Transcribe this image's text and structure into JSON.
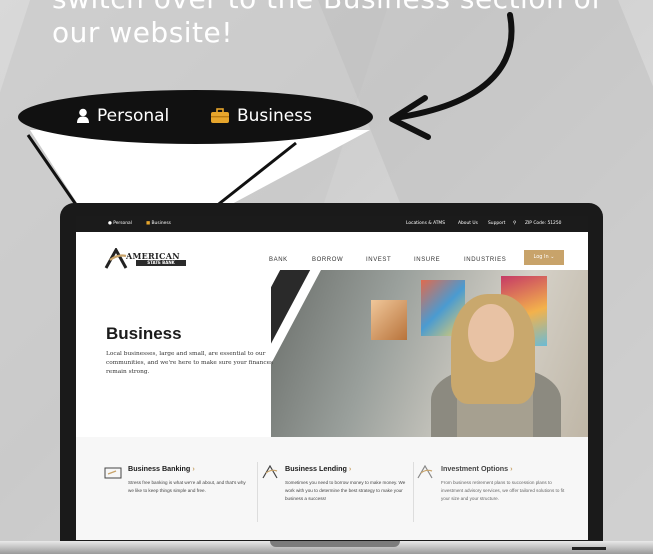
{
  "headline": {
    "line1": "switch over to the Business section of",
    "line2": "our website!"
  },
  "pill": {
    "personal_label": "Personal",
    "business_label": "Business"
  },
  "topbar": {
    "personal": "Personal",
    "business": "Business",
    "locations": "Locations & ATMS",
    "about": "About Us",
    "support": "Support",
    "zip": "ZIP Code: 51250"
  },
  "logo": {
    "name": "AMERICAN",
    "sub": "STATE BANK"
  },
  "nav": {
    "bank": "BANK",
    "borrow": "BORROW",
    "invest": "INVEST",
    "insure": "INSURE",
    "industries": "INDUSTRIES",
    "login": "Log In"
  },
  "hero": {
    "title": "Business",
    "description": "Local businesses, large and small, are essential to our communities, and we're here to make sure your finances remain strong."
  },
  "cards": [
    {
      "title": "Business Banking",
      "text": "Stress free banking is what we're all about, and that's why we like to keep things simple and free."
    },
    {
      "title": "Business Lending",
      "text": "Sometimes you need to borrow money to make money. We work with you to determine the best strategy to make your business a success!"
    },
    {
      "title": "Investment Options",
      "text": "From business retirement plans to succession plans to investment advisory services, we offer tailored solutions to fit your size and your structure."
    }
  ],
  "colors": {
    "accent": "#c8a36a",
    "topbar": "#1b1b1b",
    "pill": "#111111"
  },
  "icons": [
    "user-icon",
    "briefcase-icon",
    "search-icon",
    "chevron-down-icon",
    "arrow-icon"
  ]
}
